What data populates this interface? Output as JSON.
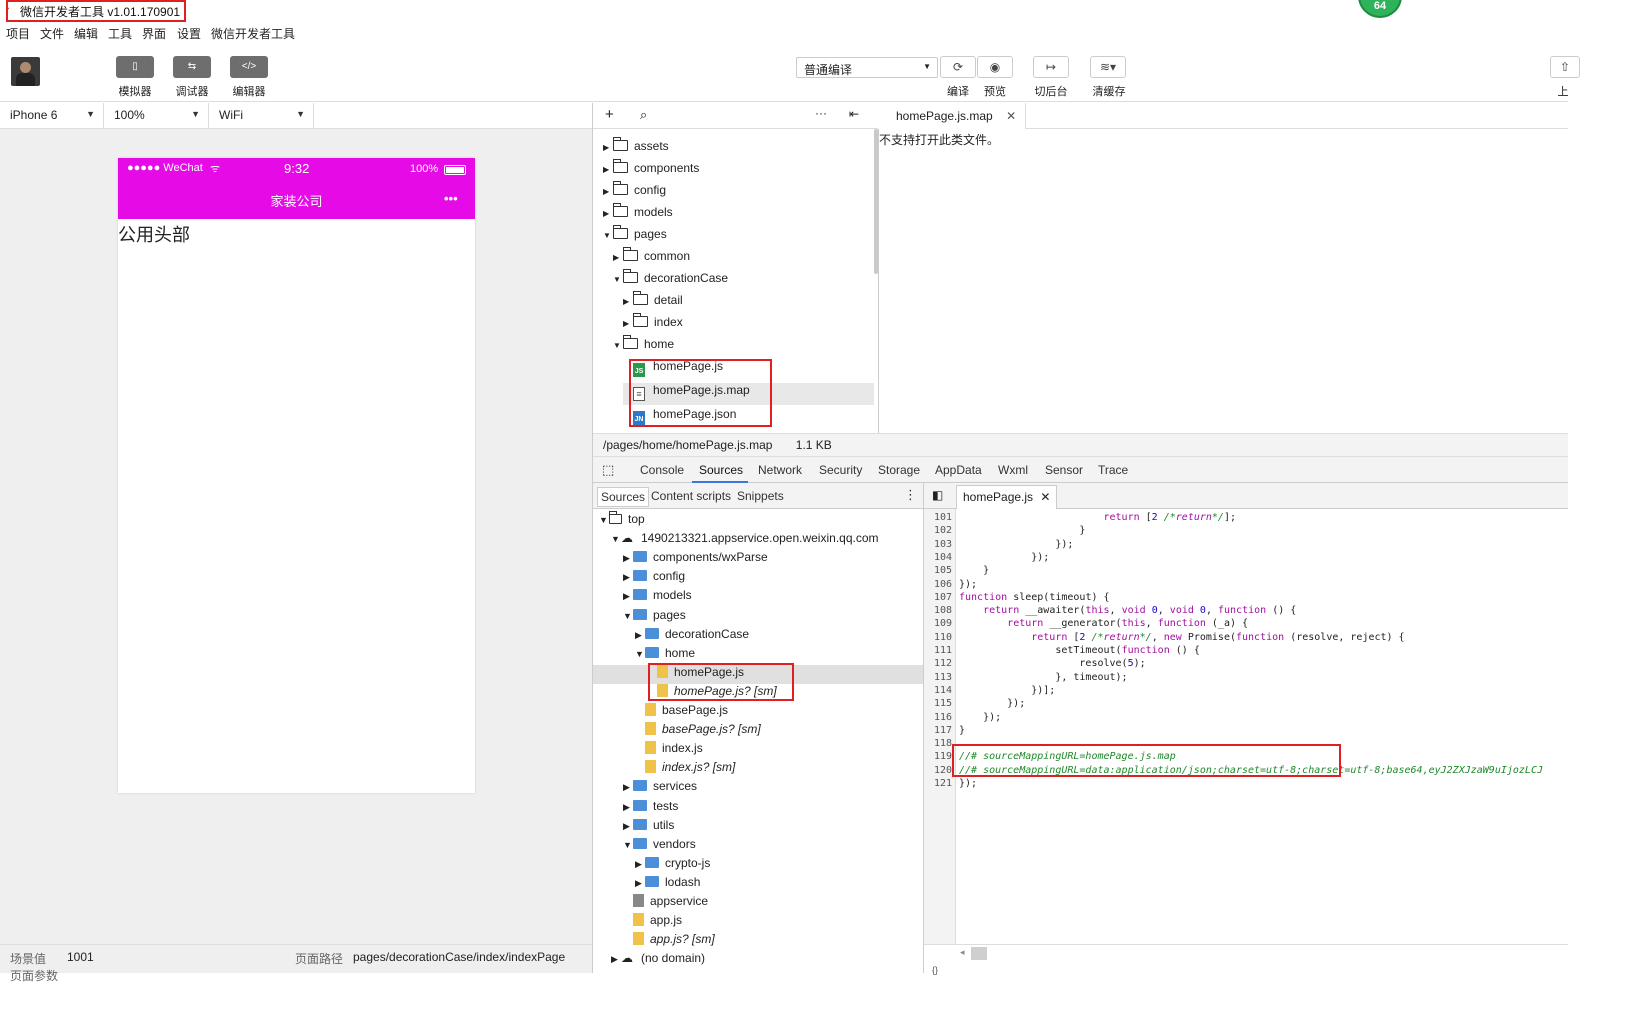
{
  "window": {
    "title": "微信开发者工具 v1.01.170901",
    "badge": "64"
  },
  "menu": [
    "项目",
    "文件",
    "编辑",
    "工具",
    "界面",
    "设置",
    "微信开发者工具"
  ],
  "toolbar": {
    "simulator_label": "模拟器",
    "debugger_label": "调试器",
    "editor_label": "编辑器",
    "compile_mode": "普通编译",
    "compile_label": "编译",
    "preview_label": "预览",
    "background_label": "切后台",
    "clearcache_label": "清缓存",
    "upload_label": "上"
  },
  "simulator": {
    "device": "iPhone 6",
    "zoom": "100%",
    "network": "WiFi",
    "status_signal": "●●●●● WeChat",
    "status_time": "9:32",
    "status_battery": "100%",
    "nav_title": "家装公司",
    "nav_more": "•••",
    "page_text": "公用头部",
    "header_color": "#e60ae6"
  },
  "statusbar": {
    "scene_label": "场景值",
    "scene_value": "1001",
    "path_label": "页面路径",
    "path_value": "pages/decorationCase/index/indexPage",
    "params_label": "页面参数"
  },
  "filetree": [
    {
      "name": "assets",
      "type": "folder",
      "indent": 0,
      "expanded": false
    },
    {
      "name": "components",
      "type": "folder",
      "indent": 0,
      "expanded": false
    },
    {
      "name": "config",
      "type": "folder",
      "indent": 0,
      "expanded": false
    },
    {
      "name": "models",
      "type": "folder",
      "indent": 0,
      "expanded": false
    },
    {
      "name": "pages",
      "type": "folder",
      "indent": 0,
      "expanded": true
    },
    {
      "name": "common",
      "type": "folder",
      "indent": 1,
      "expanded": false
    },
    {
      "name": "decorationCase",
      "type": "folder",
      "indent": 1,
      "expanded": true
    },
    {
      "name": "detail",
      "type": "folder",
      "indent": 2,
      "expanded": false
    },
    {
      "name": "index",
      "type": "folder",
      "indent": 2,
      "expanded": false
    },
    {
      "name": "home",
      "type": "folder",
      "indent": 1,
      "expanded": true
    },
    {
      "name": "homePage.js",
      "type": "js",
      "indent": 2
    },
    {
      "name": "homePage.js.map",
      "type": "map",
      "indent": 2
    },
    {
      "name": "homePage.json",
      "type": "json",
      "indent": 2
    }
  ],
  "editor": {
    "tab_name": "homePage.js.map",
    "message": "不支持打开此类文件。",
    "file_path": "/pages/home/homePage.js.map",
    "file_size": "1.1 KB"
  },
  "devtools": {
    "tabs": [
      "Console",
      "Sources",
      "Network",
      "Security",
      "Storage",
      "AppData",
      "Wxml",
      "Sensor",
      "Trace"
    ],
    "active_tab": "Sources",
    "subtabs": [
      "Sources",
      "Content scripts",
      "Snippets"
    ],
    "code_tab": "homePage.js"
  },
  "sources_tree": [
    {
      "name": "top",
      "kind": "frame",
      "indent": 0,
      "arrow": "▼"
    },
    {
      "name": "1490213321.appservice.open.weixin.qq.com",
      "kind": "cloud",
      "indent": 1,
      "arrow": "▼"
    },
    {
      "name": "components/wxParse",
      "kind": "folder",
      "indent": 2,
      "arrow": "▶"
    },
    {
      "name": "config",
      "kind": "folder",
      "indent": 2,
      "arrow": "▶"
    },
    {
      "name": "models",
      "kind": "folder",
      "indent": 2,
      "arrow": "▶"
    },
    {
      "name": "pages",
      "kind": "folder",
      "indent": 2,
      "arrow": "▼"
    },
    {
      "name": "decorationCase",
      "kind": "folder",
      "indent": 3,
      "arrow": "▶"
    },
    {
      "name": "home",
      "kind": "folder",
      "indent": 3,
      "arrow": "▼"
    },
    {
      "name": "homePage.js",
      "kind": "file",
      "indent": 4,
      "arrow": ""
    },
    {
      "name": "homePage.js? [sm]",
      "kind": "file-sm",
      "indent": 4,
      "arrow": ""
    },
    {
      "name": "basePage.js",
      "kind": "file",
      "indent": 3,
      "arrow": ""
    },
    {
      "name": "basePage.js? [sm]",
      "kind": "file-sm",
      "indent": 3,
      "arrow": ""
    },
    {
      "name": "index.js",
      "kind": "file",
      "indent": 3,
      "arrow": ""
    },
    {
      "name": "index.js? [sm]",
      "kind": "file-sm",
      "indent": 3,
      "arrow": ""
    },
    {
      "name": "services",
      "kind": "folder",
      "indent": 2,
      "arrow": "▶"
    },
    {
      "name": "tests",
      "kind": "folder",
      "indent": 2,
      "arrow": "▶"
    },
    {
      "name": "utils",
      "kind": "folder",
      "indent": 2,
      "arrow": "▶"
    },
    {
      "name": "vendors",
      "kind": "folder",
      "indent": 2,
      "arrow": "▼"
    },
    {
      "name": "crypto-js",
      "kind": "folder",
      "indent": 3,
      "arrow": "▶"
    },
    {
      "name": "lodash",
      "kind": "folder",
      "indent": 3,
      "arrow": "▶"
    },
    {
      "name": "appservice",
      "kind": "file-grey",
      "indent": 2,
      "arrow": ""
    },
    {
      "name": "app.js",
      "kind": "file",
      "indent": 2,
      "arrow": ""
    },
    {
      "name": "app.js? [sm]",
      "kind": "file-sm",
      "indent": 2,
      "arrow": ""
    },
    {
      "name": "(no domain)",
      "kind": "cloud",
      "indent": 1,
      "arrow": "▶"
    }
  ],
  "code_lines": [
    {
      "n": "101",
      "text": "                        return [2 /*return*/];"
    },
    {
      "n": "102",
      "text": "                    }"
    },
    {
      "n": "103",
      "text": "                });"
    },
    {
      "n": "104",
      "text": "            });"
    },
    {
      "n": "105",
      "text": "    }"
    },
    {
      "n": "106",
      "text": "});"
    },
    {
      "n": "107",
      "text": "function sleep(timeout) {"
    },
    {
      "n": "108",
      "text": "    return __awaiter(this, void 0, void 0, function () {"
    },
    {
      "n": "109",
      "text": "        return __generator(this, function (_a) {"
    },
    {
      "n": "110",
      "text": "            return [2 /*return*/, new Promise(function (resolve, reject) {"
    },
    {
      "n": "111",
      "text": "                setTimeout(function () {"
    },
    {
      "n": "112",
      "text": "                    resolve(5);"
    },
    {
      "n": "113",
      "text": "                }, timeout);"
    },
    {
      "n": "114",
      "text": "            })];"
    },
    {
      "n": "115",
      "text": "        });"
    },
    {
      "n": "116",
      "text": "    });"
    },
    {
      "n": "117",
      "text": "}"
    },
    {
      "n": "118",
      "text": ""
    },
    {
      "n": "119",
      "text": "//# sourceMappingURL=homePage.js.map"
    },
    {
      "n": "120",
      "text": "//# sourceMappingURL=data:application/json;charset=utf-8;charset=utf-8;base64,eyJ2ZXJzaW9uIjozLCJ"
    },
    {
      "n": "121",
      "text": "});"
    }
  ]
}
